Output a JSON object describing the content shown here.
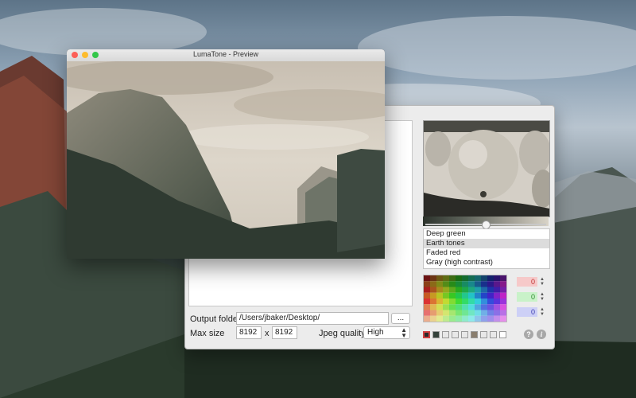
{
  "colors": {
    "close": "#fc5f57",
    "minimize": "#fdbc2e",
    "zoom": "#33c748",
    "sepia_light": "#d6cfc4",
    "sepia_dark": "#2f3a30"
  },
  "preview_window": {
    "title": "LumaTone - Preview",
    "close_icon": "close-icon",
    "minimize_icon": "minimize-icon",
    "zoom_icon": "zoom-icon"
  },
  "main_window": {
    "output_folder": {
      "label": "Output folder",
      "value": "/Users/jbaker/Desktop/",
      "browse_label": "..."
    },
    "max_size": {
      "label": "Max size",
      "width": "8192",
      "separator": "x",
      "height": "8192"
    },
    "jpeg_quality": {
      "label": "Jpeg quality",
      "selected": "High"
    },
    "presets": [
      {
        "label": "Deep green",
        "selected": false
      },
      {
        "label": "Earth tones",
        "selected": true
      },
      {
        "label": "Faded red",
        "selected": false
      },
      {
        "label": "Gray (high contrast)",
        "selected": false
      }
    ],
    "color_values": {
      "red": "0",
      "green": "0",
      "blue": "0"
    },
    "help_label": "?",
    "info_label": "i"
  }
}
